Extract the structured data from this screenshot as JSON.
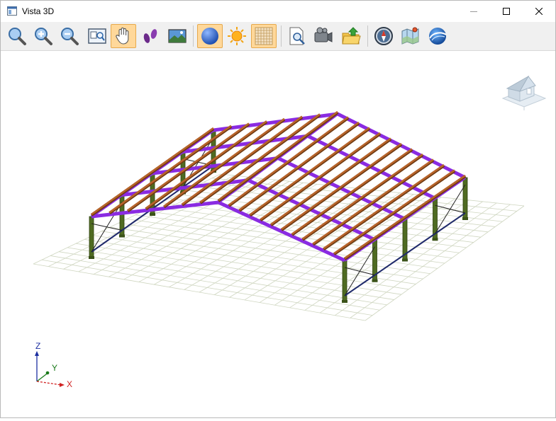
{
  "window": {
    "title": "Vista 3D"
  },
  "axes": {
    "z": "Z",
    "y": "Y",
    "x": "X"
  },
  "colors": {
    "toolbar_bg": "#f0f0f0",
    "active_button": "#ffd89a",
    "rafter": "#8a2be2",
    "purlin": "#b8642a",
    "column": "#4f6b22",
    "bracing": "#1f2a6b",
    "grid": "#cfd6c0"
  },
  "toolbar": [
    {
      "name": "zoom-icon",
      "active": false
    },
    {
      "name": "zoom-in-icon",
      "active": false
    },
    {
      "name": "zoom-out-icon",
      "active": false
    },
    {
      "name": "zoom-window-icon",
      "active": false
    },
    {
      "name": "pan-hand-icon",
      "active": true
    },
    {
      "name": "walk-footprints-icon",
      "active": false
    },
    {
      "name": "background-image-icon",
      "active": false
    },
    {
      "name": "sphere-render-icon",
      "active": true
    },
    {
      "name": "sun-light-icon",
      "active": false
    },
    {
      "name": "grid-icon",
      "active": true
    },
    {
      "name": "print-preview-icon",
      "active": false
    },
    {
      "name": "video-camera-icon",
      "active": false
    },
    {
      "name": "export-folder-icon",
      "active": false
    },
    {
      "name": "compass-icon",
      "active": false
    },
    {
      "name": "map-icon",
      "active": false
    },
    {
      "name": "google-earth-icon",
      "active": false
    }
  ]
}
